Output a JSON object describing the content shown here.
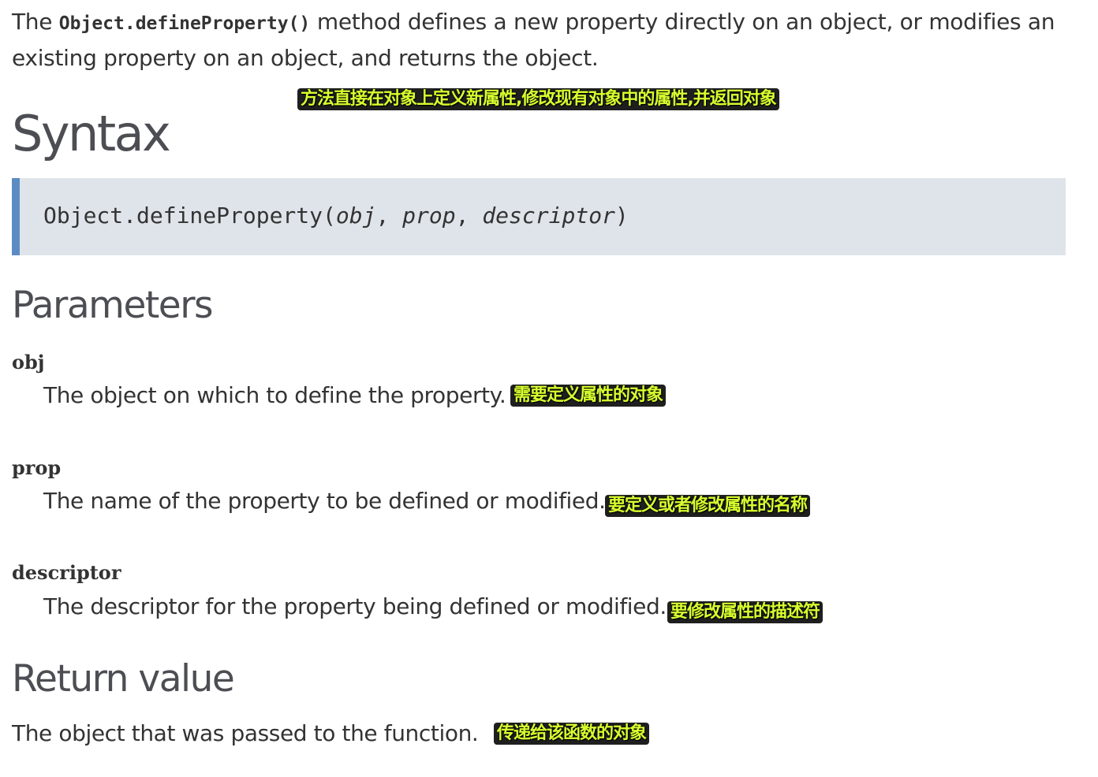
{
  "intro": {
    "prefix": "The ",
    "code": "Object.defineProperty()",
    "suffix": " method defines a new property directly on an object, or modifies an existing property on an object, and returns the object.",
    "annotation": "方法直接在对象上定义新属性,修改现有对象中的属性,并返回对象"
  },
  "syntax": {
    "heading": "Syntax",
    "call_prefix": "Object.defineProperty(",
    "arg1": "obj",
    "sep1": ", ",
    "arg2": "prop",
    "sep2": ", ",
    "arg3": "descriptor",
    "call_suffix": ")"
  },
  "parameters": {
    "heading": "Parameters",
    "items": [
      {
        "name": "obj",
        "description": "The object on which to define the property.",
        "annotation": "需要定义属性的对象"
      },
      {
        "name": "prop",
        "description": "The name of the property to be defined or modified.",
        "annotation": "要定义或者修改属性的名称"
      },
      {
        "name": "descriptor",
        "description": "The descriptor for the property being defined or modified.",
        "annotation": "要修改属性的描述符"
      }
    ]
  },
  "return_value": {
    "heading": "Return value",
    "description": "The object that was passed to the function.",
    "annotation": "传递给该函数的对象"
  },
  "colors": {
    "heading": "#4d4e53",
    "text": "#333333",
    "syntax_bg": "#dfe4ea",
    "syntax_border": "#5b8bc3",
    "annotation_text": "#d8ff2e",
    "annotation_bg": "#000000"
  }
}
